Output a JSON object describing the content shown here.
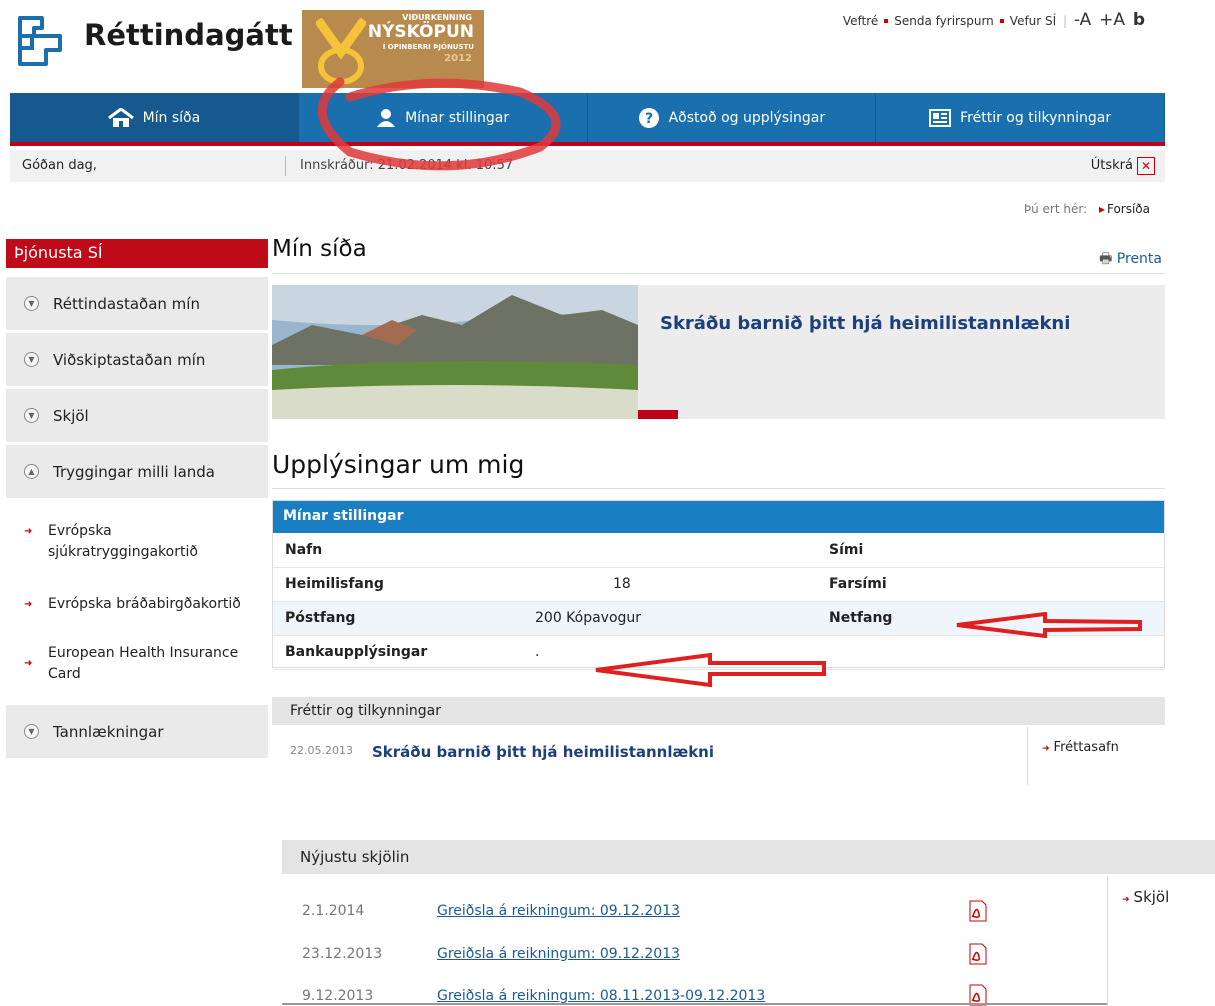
{
  "header": {
    "brand": "Réttindagátt",
    "award": {
      "l1": "VIÐURKENNING",
      "l2": "NÝSKÖPUN",
      "l3": "Í OPINBERRI ÞJÓNUSTU",
      "l4": "2012"
    },
    "links": [
      "Veftré",
      "Senda fyrirspurn",
      "Vefur SÍ"
    ],
    "font_size": {
      "minus": "-A",
      "plus": "+A",
      "b": "b"
    }
  },
  "nav": [
    {
      "label": "Mín síða",
      "icon": "home-icon"
    },
    {
      "label": "Mínar stillingar",
      "icon": "user-icon"
    },
    {
      "label": "Aðstoð og upplýsingar",
      "icon": "help-icon"
    },
    {
      "label": "Fréttir og tilkynningar",
      "icon": "news-icon"
    }
  ],
  "greeting": {
    "hello": "Góðan dag,",
    "login": "Innskráður: 21.02.2014 kl. 10:57",
    "logout": "Útskrá"
  },
  "breadcrumb": {
    "label": "Þú ert hér:",
    "current": "Forsíða"
  },
  "sidebar": {
    "title": "Þjónusta SÍ",
    "items": [
      "Réttindastaðan mín",
      "Viðskiptastaðan mín",
      "Skjöl",
      "Tryggingar milli landa"
    ],
    "subitems": [
      "Evrópska sjúkratryggingakortið",
      "Evrópska bráðabirgðakortið",
      "European Health Insurance Card"
    ],
    "last": "Tannlækningar"
  },
  "main": {
    "title": "Mín síða",
    "print": "Prenta",
    "banner_title": "Skráðu barnið þitt hjá heimilistannlækni",
    "info_title": "Upplýsingar um mig",
    "info_bar": "Mínar stillingar",
    "rows": [
      {
        "k1": "Nafn",
        "v1": "",
        "k2": "Sími",
        "v2": ""
      },
      {
        "k1": "Heimilisfang",
        "v1": "18",
        "k2": "Farsími",
        "v2": ""
      },
      {
        "k1": "Póstfang",
        "v1": "200 Kópavogur",
        "k2": "Netfang",
        "v2": ""
      },
      {
        "k1": "Bankaupplýsingar",
        "v1": ".",
        "k2": "",
        "v2": ""
      }
    ]
  },
  "news": {
    "bar": "Fréttir og tilkynningar",
    "date": "22.05.2013",
    "title": "Skráðu barnið þitt hjá heimilistannlækni",
    "archive": "Fréttasafn"
  },
  "docs": {
    "bar": "Nýjustu skjölin",
    "link": "Skjöl",
    "rows": [
      {
        "date": "2.1.2014",
        "title": "Greiðsla á reikningum: 09.12.2013"
      },
      {
        "date": "23.12.2013",
        "title": "Greiðsla á reikningum: 09.12.2013"
      },
      {
        "date": "9.12.2013",
        "title": "Greiðsla á reikningum: 08.11.2013-09.12.2013"
      }
    ]
  }
}
